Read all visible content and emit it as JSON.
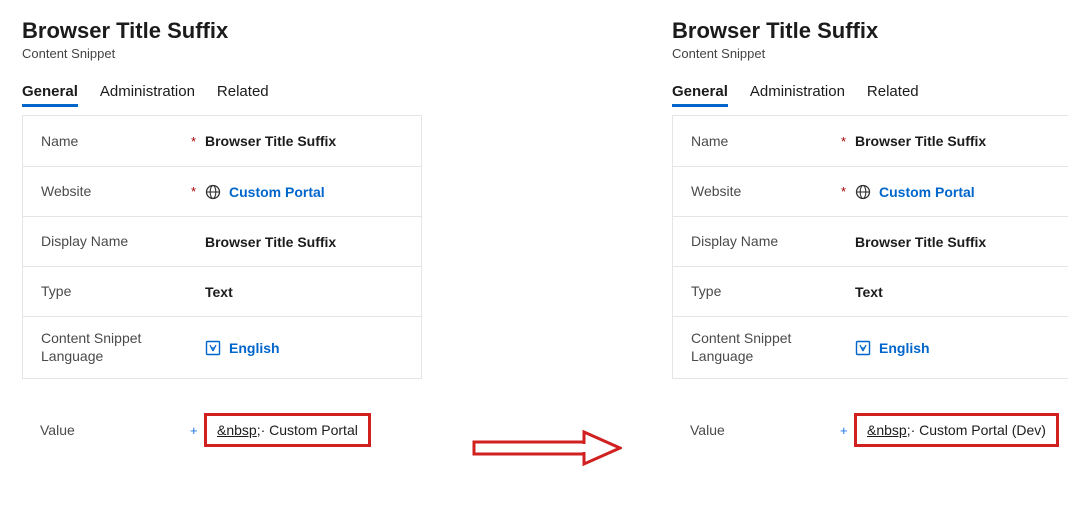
{
  "left": {
    "title": "Browser Title Suffix",
    "subtitle": "Content Snippet",
    "tabs": {
      "general": "General",
      "administration": "Administration",
      "related": "Related"
    },
    "fields": {
      "name_label": "Name",
      "name_value": "Browser Title Suffix",
      "website_label": "Website",
      "website_value": "Custom Portal",
      "displayname_label": "Display Name",
      "displayname_value": "Browser Title Suffix",
      "type_label": "Type",
      "type_value": "Text",
      "lang_label": "Content Snippet Language",
      "lang_value": "English"
    },
    "value_label": "Value",
    "value_amp": "&nbsp",
    "value_rest": ";· Custom Portal"
  },
  "right": {
    "title": "Browser Title Suffix",
    "subtitle": "Content Snippet",
    "tabs": {
      "general": "General",
      "administration": "Administration",
      "related": "Related"
    },
    "fields": {
      "name_label": "Name",
      "name_value": "Browser Title Suffix",
      "website_label": "Website",
      "website_value": "Custom Portal",
      "displayname_label": "Display Name",
      "displayname_value": "Browser Title Suffix",
      "type_label": "Type",
      "type_value": "Text",
      "lang_label": "Content Snippet Language",
      "lang_value": "English"
    },
    "value_label": "Value",
    "value_amp": "&nbsp",
    "value_rest": ";· Custom Portal (Dev)"
  },
  "req_star": "*",
  "req_plus": "+"
}
